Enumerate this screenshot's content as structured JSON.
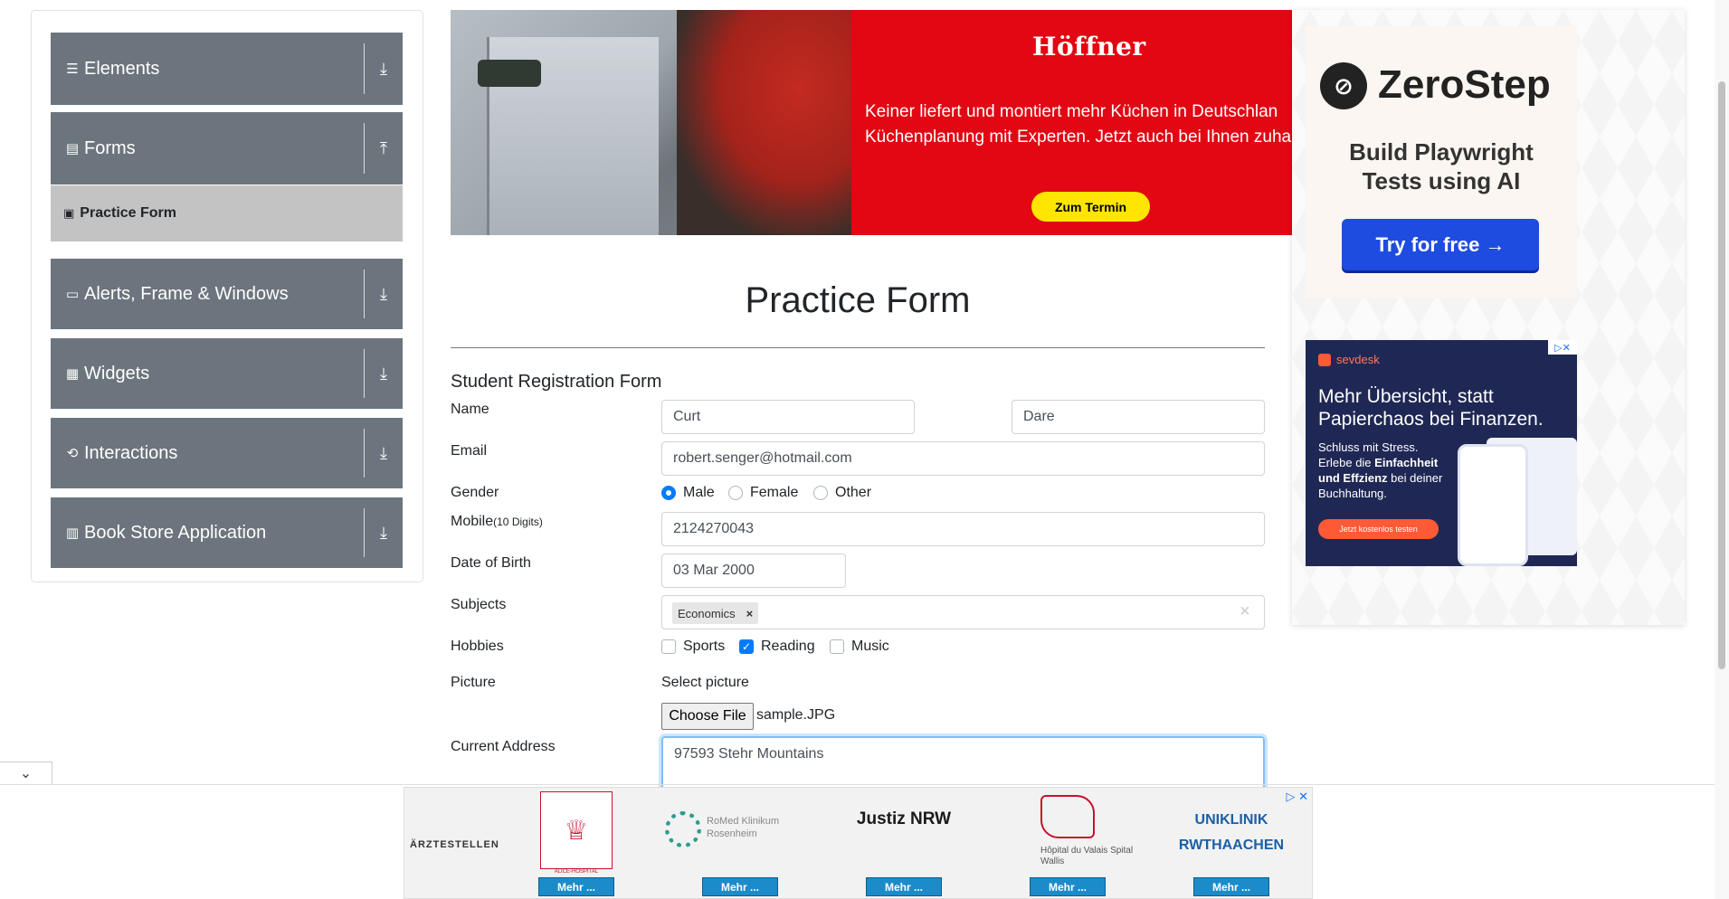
{
  "sidebar": {
    "groups": [
      {
        "label": "Elements",
        "icon": "hamburger-icon",
        "arrow": "download-arrow-icon"
      },
      {
        "label": "Forms",
        "icon": "document-icon",
        "arrow": "upload-arrow-icon"
      },
      {
        "label": "Alerts, Frame & Windows",
        "icon": "window-icon",
        "arrow": "download-arrow-icon"
      },
      {
        "label": "Widgets",
        "icon": "widgets-icon",
        "arrow": "download-arrow-icon"
      },
      {
        "label": "Interactions",
        "icon": "interactions-icon",
        "arrow": "download-arrow-icon"
      },
      {
        "label": "Book Store Application",
        "icon": "books-icon",
        "arrow": "download-arrow-icon"
      }
    ],
    "active_item": "Practice Form"
  },
  "ad_top": {
    "brand": "Höffner",
    "line1": "Keiner liefert und montiert mehr Küchen in Deutschlan",
    "line2": "Küchenplanung mit Experten. Jetzt auch bei Ihnen zuhau",
    "cta": "Zum Termin"
  },
  "ad_right_1": {
    "brand": "ZeroStep",
    "headline_1": "Build Playwright",
    "headline_2": "Tests using AI",
    "cta": "Try for free →"
  },
  "ad_right_2": {
    "brand": "sevdesk",
    "headline": "Mehr Übersicht, statt Papierchaos bei Finanzen.",
    "body_1": "Schluss mit Stress. Erlebe die",
    "body_bold_1": "Einfachheit und Effzienz",
    "body_2": "bei deiner Buchhaltung.",
    "cta": "Jetzt kostenlos testen"
  },
  "form": {
    "title": "Practice Form",
    "subtitle": "Student Registration Form",
    "name_label": "Name",
    "first_name": "Curt",
    "last_name": "Dare",
    "email_label": "Email",
    "email": "robert.senger@hotmail.com",
    "gender_label": "Gender",
    "genders": [
      "Male",
      "Female",
      "Other"
    ],
    "selected_gender": "Male",
    "mobile_label": "Mobile",
    "mobile_hint": "(10 Digits)",
    "mobile": "2124270043",
    "dob_label": "Date of Birth",
    "dob": "03 Mar 2000",
    "subjects_label": "Subjects",
    "subjects": [
      "Economics"
    ],
    "subject_remove": "×",
    "subjects_clear": "×",
    "hobbies_label": "Hobbies",
    "hobbies": [
      {
        "label": "Sports",
        "checked": false
      },
      {
        "label": "Reading",
        "checked": true
      },
      {
        "label": "Music",
        "checked": false
      }
    ],
    "picture_label": "Picture",
    "select_picture": "Select picture",
    "choose_file": "Choose File",
    "file_name": "sample.JPG",
    "address_label": "Current Address",
    "address": "97593 Stehr Mountains"
  },
  "bottom_ad": {
    "brand": "ÄRZTESTELLEN",
    "items": [
      {
        "name": "ALICE-HOSPITAL",
        "button": "Mehr ..."
      },
      {
        "name": "RoMed Klinikum Rosenheim",
        "button": "Mehr ..."
      },
      {
        "name": "Justiz NRW",
        "button": "Mehr ..."
      },
      {
        "name": "Hôpital du Valais Spital Wallis",
        "button": "Mehr ..."
      },
      {
        "name": "UNIKLINIK RWTHAACHEN",
        "button": "Mehr ..."
      }
    ],
    "adchoices": "▷ ✕"
  }
}
